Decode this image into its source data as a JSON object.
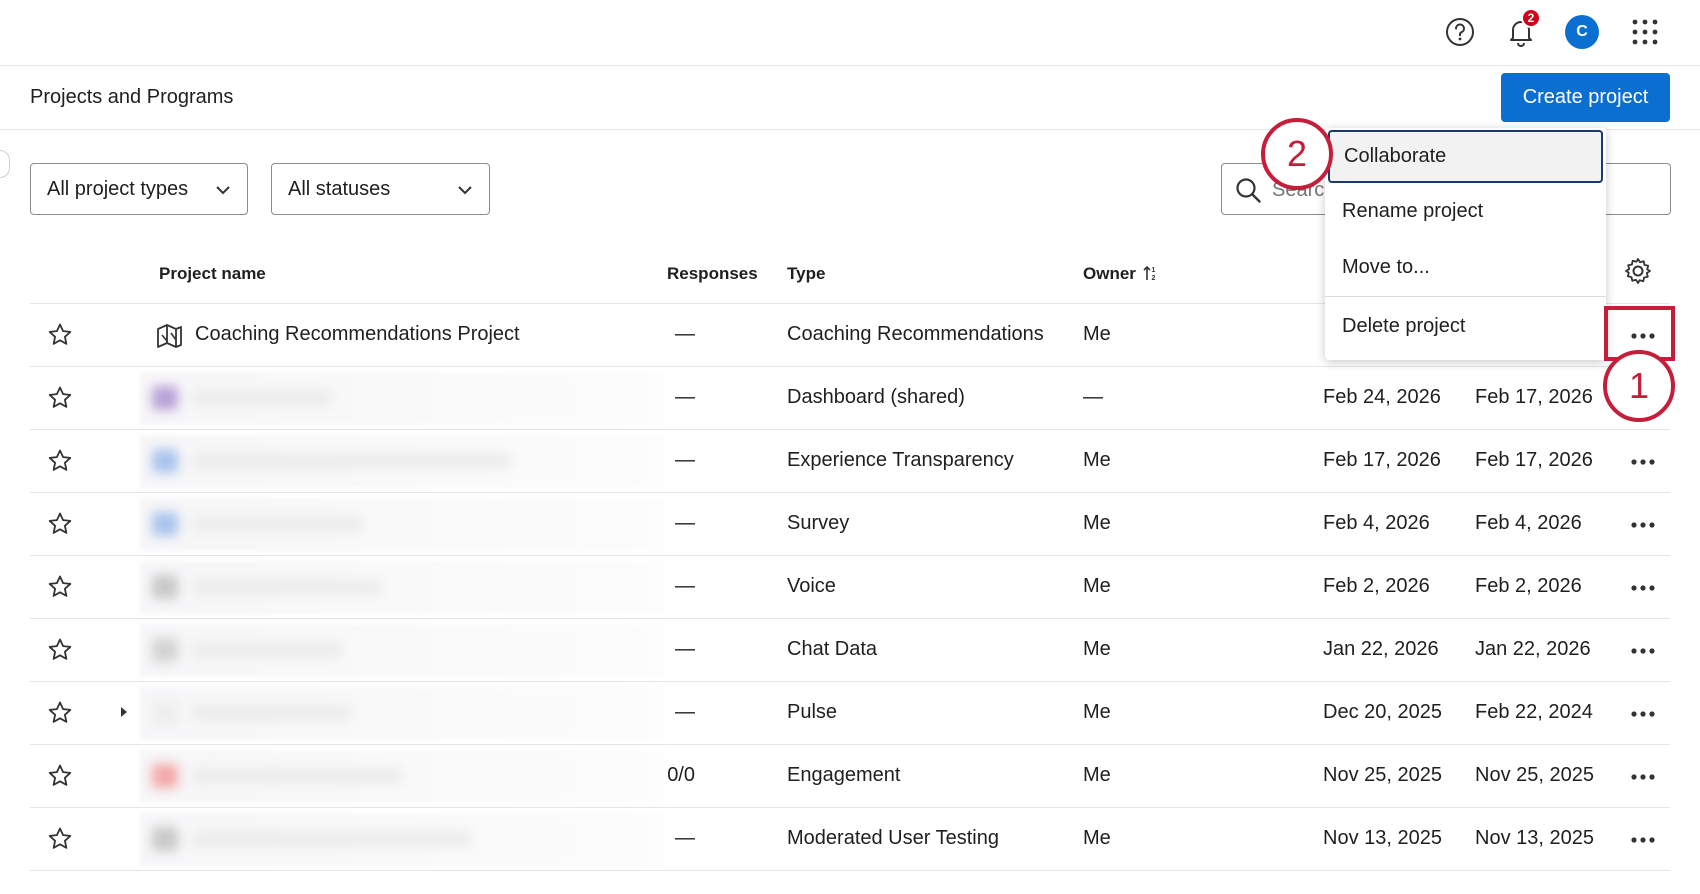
{
  "topbar": {
    "help_icon": "help-circle-icon",
    "notifications_icon": "bell-icon",
    "notification_count": "2",
    "avatar_initial": "C",
    "apps_icon": "grid-icon"
  },
  "header": {
    "title": "Projects and Programs",
    "create_label": "Create project"
  },
  "filters": {
    "project_types": "All project types",
    "statuses": "All statuses",
    "search_placeholder": "Search"
  },
  "table": {
    "columns": {
      "name": "Project name",
      "responses": "Responses",
      "type": "Type",
      "owner": "Owner"
    },
    "rows": [
      {
        "name": "Coaching Recommendations Project",
        "responses": "—",
        "type": "Coaching Recommendations",
        "owner": "Me",
        "date1": "",
        "date2": ""
      },
      {
        "name": "",
        "responses": "—",
        "type": "Dashboard (shared)",
        "owner": "—",
        "date1": "Feb 24, 2026",
        "date2": "Feb 17, 2026"
      },
      {
        "name": "",
        "responses": "—",
        "type": "Experience Transparency",
        "owner": "Me",
        "date1": "Feb 17, 2026",
        "date2": "Feb 17, 2026"
      },
      {
        "name": "",
        "responses": "—",
        "type": "Survey",
        "owner": "Me",
        "date1": "Feb 4, 2026",
        "date2": "Feb 4, 2026"
      },
      {
        "name": "",
        "responses": "—",
        "type": "Voice",
        "owner": "Me",
        "date1": "Feb 2, 2026",
        "date2": "Feb 2, 2026"
      },
      {
        "name": "",
        "responses": "—",
        "type": "Chat Data",
        "owner": "Me",
        "date1": "Jan 22, 2026",
        "date2": "Jan 22, 2026"
      },
      {
        "name": "",
        "responses": "—",
        "type": "Pulse",
        "owner": "Me",
        "date1": "Dec 20, 2025",
        "date2": "Feb 22, 2024"
      },
      {
        "name": "",
        "responses": "0/0",
        "type": "Engagement",
        "owner": "Me",
        "date1": "Nov 25, 2025",
        "date2": "Nov 25, 2025"
      },
      {
        "name": "",
        "responses": "—",
        "type": "Moderated User Testing",
        "owner": "Me",
        "date1": "Nov 13, 2025",
        "date2": "Nov 13, 2025"
      }
    ]
  },
  "menu": {
    "items": [
      "Collaborate",
      "Rename project",
      "Move to...",
      "Delete project"
    ]
  },
  "annotations": {
    "step1": "1",
    "step2": "2"
  },
  "colors": {
    "brand_blue": "#0b6ed1",
    "annotation_red": "#c41e3a",
    "badge_red": "#d0021b"
  }
}
